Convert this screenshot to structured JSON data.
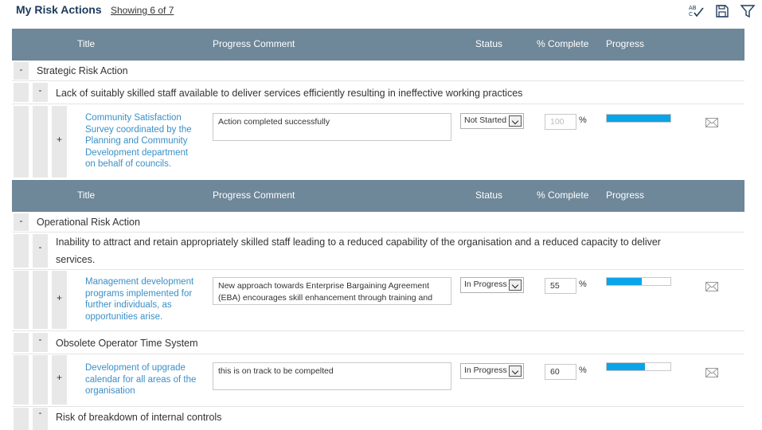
{
  "page": {
    "title": "My Risk Actions",
    "showing": "Showing 6 of 7"
  },
  "toolbar": {
    "icons": [
      "spellcheck-icon",
      "save-icon",
      "filter-icon"
    ],
    "spellcheck_text_top": "AB",
    "spellcheck_text_bottom": "C"
  },
  "columns": {
    "title": "Title",
    "progress_comment": "Progress Comment",
    "status": "Status",
    "percent_complete": "% Complete",
    "progress": "Progress"
  },
  "collapse_symbol": "-",
  "expand_symbol": "+",
  "percent_sign": "%",
  "groups": [
    {
      "name": "Strategic Risk Action",
      "risks": [
        {
          "name": "Lack of suitably skilled staff available to deliver services efficiently resulting in ineffective working practices",
          "actions": [
            {
              "title_lines": [
                "Community Satisfaction",
                "Survey coordinated by the",
                "Planning and Community",
                "Development department",
                "on behalf of councils."
              ],
              "comment_lines": [
                "Action completed successfully"
              ],
              "status": "Not Started",
              "percent": "100",
              "percent_disabled": true,
              "progress_fraction": 1.0
            }
          ]
        }
      ]
    },
    {
      "name": "Operational Risk Action",
      "risks": [
        {
          "name_lines": [
            "Inability to attract and retain appropriately skilled staff leading to a reduced capability of the organisation and a reduced capacity to deliver",
            "services."
          ],
          "actions": [
            {
              "title_lines": [
                "Management development",
                "programs implemented for",
                "further individuals, as",
                "opportunities arise."
              ],
              "comment_lines": [
                "New approach towards Enterprise Bargaining Agreement",
                "(EBA) encourages skill enhancement through training and"
              ],
              "status": "In Progress",
              "percent": "55",
              "percent_disabled": false,
              "progress_fraction": 0.55
            }
          ]
        },
        {
          "name": "Obsolete Operator Time System",
          "actions": [
            {
              "title_lines": [
                "Development of upgrade",
                "calendar for all areas of the",
                "organisation"
              ],
              "comment_lines": [
                "this is on track to be compelted"
              ],
              "status": "In Progress",
              "percent": "60",
              "percent_disabled": false,
              "progress_fraction": 0.6
            }
          ]
        },
        {
          "name": "Risk of breakdown of internal controls",
          "actions": []
        }
      ]
    }
  ],
  "colors": {
    "header_bg": "#6e8799",
    "link": "#3a8fc8",
    "progress_fill": "#0aa4e8",
    "title": "#1d3a5c"
  }
}
